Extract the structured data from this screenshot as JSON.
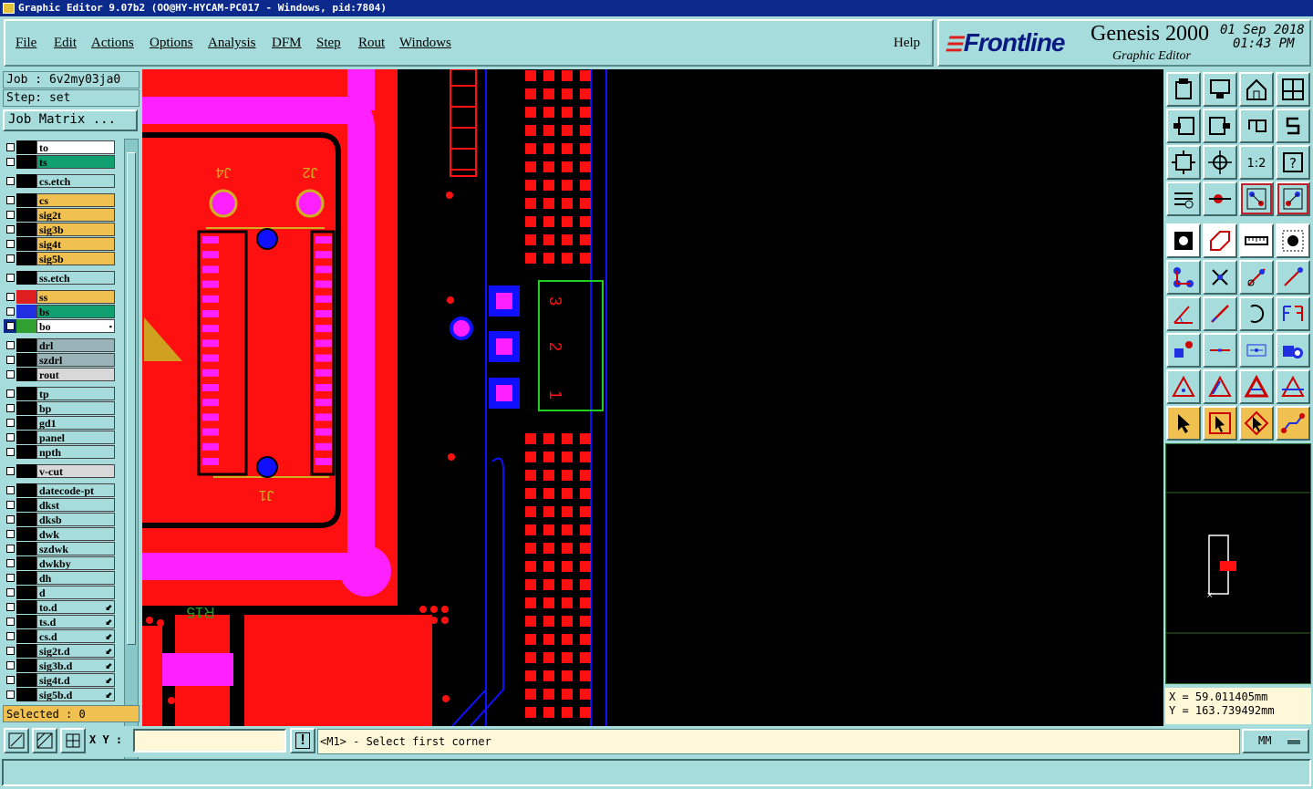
{
  "window": {
    "title": "Graphic Editor 9.07b2 (OO@HY-HYCAM-PC017 - Windows, pid:7804)"
  },
  "menu": {
    "items": [
      "File",
      "Edit",
      "Actions",
      "Options",
      "Analysis",
      "DFM",
      "Step",
      "Rout",
      "Windows"
    ],
    "help": "Help"
  },
  "brand": {
    "logo": "Frontline",
    "product": "Genesis 2000",
    "subtitle": "Graphic Editor",
    "date": "01 Sep 2018",
    "time": "01:43 PM"
  },
  "job": {
    "job": "Job : 6v2my03ja0",
    "step": "Step: set",
    "matrix_button": "Job Matrix ..."
  },
  "layers": [
    {
      "name": "to",
      "bg": "#ffffff",
      "sw": "#000000"
    },
    {
      "name": "ts",
      "bg": "#10a070",
      "sw": "#000000"
    },
    {
      "name": "cs.etch",
      "bg": "#a6dcdc",
      "sw": "#000000",
      "gap": true
    },
    {
      "name": "cs",
      "bg": "#f0c050",
      "sw": "#000000",
      "gap": true
    },
    {
      "name": "sig2t",
      "bg": "#f0c050",
      "sw": "#000000"
    },
    {
      "name": "sig3b",
      "bg": "#f0c050",
      "sw": "#000000"
    },
    {
      "name": "sig4t",
      "bg": "#f0c050",
      "sw": "#000000"
    },
    {
      "name": "sig5b",
      "bg": "#f0c050",
      "sw": "#000000"
    },
    {
      "name": "ss.etch",
      "bg": "#a6dcdc",
      "sw": "#000000",
      "gap": true
    },
    {
      "name": "ss",
      "bg": "#f0c050",
      "sw": "#e02020",
      "gap": true
    },
    {
      "name": "bs",
      "bg": "#10a070",
      "sw": "#2030e0"
    },
    {
      "name": "bo",
      "bg": "#ffffff",
      "sw": "#30a030",
      "mark": "▪",
      "cbdark": true
    },
    {
      "name": "drl",
      "bg": "#98b4b8",
      "sw": "#000000",
      "gap": true
    },
    {
      "name": "szdrl",
      "bg": "#98b4b8",
      "sw": "#000000"
    },
    {
      "name": "rout",
      "bg": "#d8d8d8",
      "sw": "#000000"
    },
    {
      "name": "tp",
      "bg": "#a6dcdc",
      "sw": "#000000",
      "gap": true
    },
    {
      "name": "bp",
      "bg": "#a6dcdc",
      "sw": "#000000"
    },
    {
      "name": "gd1",
      "bg": "#a6dcdc",
      "sw": "#000000"
    },
    {
      "name": "panel",
      "bg": "#a6dcdc",
      "sw": "#000000"
    },
    {
      "name": "npth",
      "bg": "#a6dcdc",
      "sw": "#000000"
    },
    {
      "name": "v-cut",
      "bg": "#d8d8d8",
      "sw": "#000000",
      "gap": true
    },
    {
      "name": "datecode-pt",
      "bg": "#a6dcdc",
      "sw": "#000000",
      "gap": true
    },
    {
      "name": "dkst",
      "bg": "#a6dcdc",
      "sw": "#000000"
    },
    {
      "name": "dksb",
      "bg": "#a6dcdc",
      "sw": "#000000"
    },
    {
      "name": "dwk",
      "bg": "#a6dcdc",
      "sw": "#000000"
    },
    {
      "name": "szdwk",
      "bg": "#a6dcdc",
      "sw": "#000000"
    },
    {
      "name": "dwkby",
      "bg": "#a6dcdc",
      "sw": "#000000"
    },
    {
      "name": "dh",
      "bg": "#a6dcdc",
      "sw": "#000000"
    },
    {
      "name": "d",
      "bg": "#a6dcdc",
      "sw": "#000000"
    },
    {
      "name": "to.d",
      "bg": "#a6dcdc",
      "sw": "#000000",
      "mark": "⬋"
    },
    {
      "name": "ts.d",
      "bg": "#a6dcdc",
      "sw": "#000000",
      "mark": "⬋"
    },
    {
      "name": "cs.d",
      "bg": "#a6dcdc",
      "sw": "#000000",
      "mark": "⬋"
    },
    {
      "name": "sig2t.d",
      "bg": "#a6dcdc",
      "sw": "#000000",
      "mark": "⬋"
    },
    {
      "name": "sig3b.d",
      "bg": "#a6dcdc",
      "sw": "#000000",
      "mark": "⬋"
    },
    {
      "name": "sig4t.d",
      "bg": "#a6dcdc",
      "sw": "#000000",
      "mark": "⬋"
    },
    {
      "name": "sig5b.d",
      "bg": "#a6dcdc",
      "sw": "#000000",
      "mark": "⬋"
    }
  ],
  "selected": "Selected : 0",
  "canvas": {
    "labels": {
      "j4": "J4",
      "j2": "J2",
      "j1": "J1",
      "r15": "R15",
      "pin1": "1",
      "pin2": "2",
      "pin3": "3"
    },
    "colors": {
      "copper": "#ff1010",
      "mask": "#ff20ff",
      "bottom": "#1010ff",
      "silk": "#20d020",
      "board": "#000000"
    }
  },
  "tools": [
    "open-job-icon",
    "save-icon",
    "home-icon",
    "window-split-icon",
    "prev-step-icon",
    "next-step-icon",
    "undo-icon",
    "redraw-icon",
    "zoom-fit-icon",
    "zoom-center-icon",
    "zoom-1-2-icon",
    "help-query-icon",
    "measure-tools-icon",
    "probe-icon",
    "net-highlight-icon",
    "net-compare-icon",
    "snap-pad-icon",
    "edit-shape-icon",
    "ruler-icon",
    "select-dot-icon",
    "connect-nodes-icon",
    "delete-node-icon",
    "add-line-node-icon",
    "move-node-icon",
    "angle-icon",
    "draw-line-icon",
    "arc-icon",
    "flip-f-icon",
    "select-pad-icon",
    "line-mid-icon",
    "dimension-icon",
    "resize-pad-icon",
    "triangle-a-icon",
    "triangle-b-icon",
    "triangle-c-icon",
    "triangle-d-icon",
    "select-arrow-icon",
    "select-box-icon",
    "select-rotate-icon",
    "route-icon"
  ],
  "tools_text": {
    "zoom12": "1:2"
  },
  "coords": {
    "x": "X = 59.011405mm",
    "y": "Y = 163.739492mm"
  },
  "bottom": {
    "xy_label": "X Y :",
    "xy_value": "",
    "prompt": "<M1> - Select first corner",
    "unit": "MM"
  }
}
